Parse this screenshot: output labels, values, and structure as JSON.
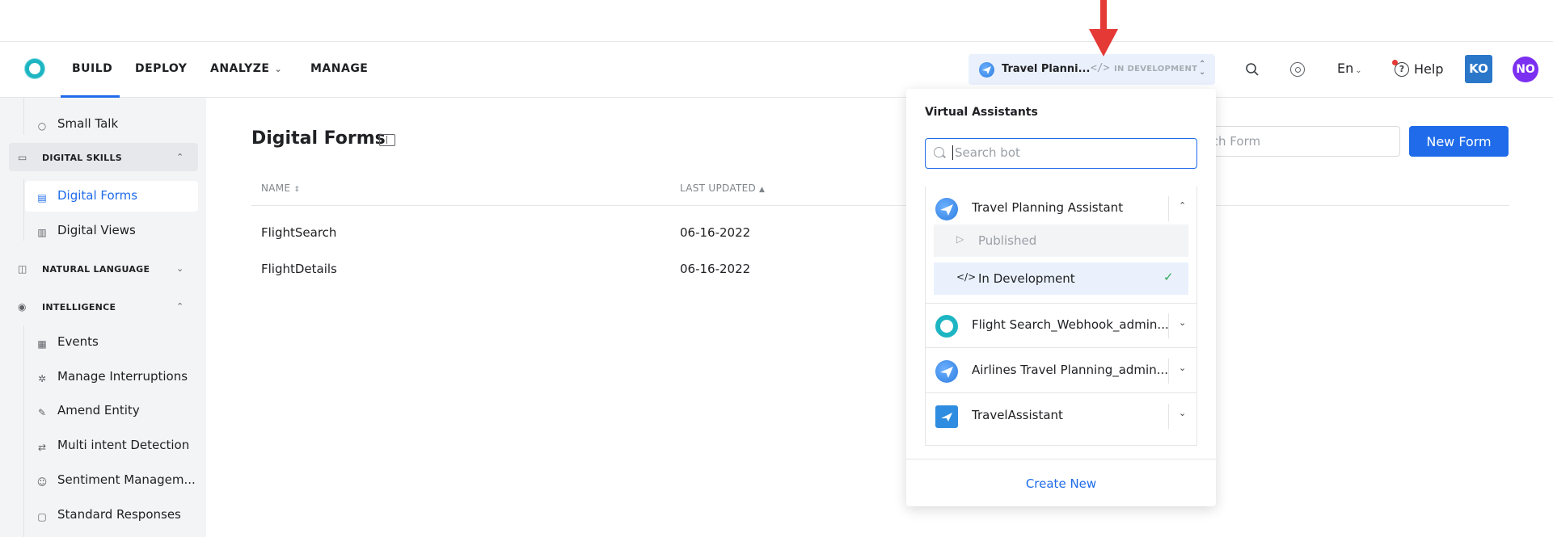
{
  "nav": {
    "items": [
      "BUILD",
      "DEPLOY",
      "ANALYZE",
      "MANAGE"
    ],
    "bot_switch": {
      "name": "Travel Planni...",
      "status": "IN DEVELOPMENT"
    },
    "language": "En",
    "help": "Help",
    "user_initials_1": "KO",
    "user_initials_2": "NO",
    "colors": {
      "accent": "#1f6bea",
      "ko": "#2a76c9",
      "no": "#7b2ff0"
    }
  },
  "sidebar": {
    "items": {
      "small_talk": "Small Talk",
      "digital_skills": "DIGITAL SKILLS",
      "digital_forms": "Digital Forms",
      "digital_views": "Digital Views",
      "natural_language": "NATURAL LANGUAGE",
      "intelligence": "INTELLIGENCE",
      "events": "Events",
      "manage_interruptions": "Manage Interruptions",
      "amend_entity": "Amend Entity",
      "multi_intent": "Multi intent Detection",
      "sentiment": "Sentiment Managem...",
      "standard_responses": "Standard Responses"
    }
  },
  "main": {
    "title": "Digital Forms",
    "search_placeholder": "Search Form",
    "new_form_label": "New Form",
    "columns": {
      "name": "NAME",
      "last_updated": "LAST UPDATED"
    },
    "rows": [
      {
        "name": "FlightSearch",
        "last_updated": "06-16-2022"
      },
      {
        "name": "FlightDetails",
        "last_updated": "06-16-2022"
      }
    ]
  },
  "dropdown": {
    "title": "Virtual Assistants",
    "search_placeholder": "Search bot",
    "bots": [
      {
        "name": "Travel Planning Assistant",
        "avatar": "plane-icon"
      },
      {
        "name": "Flight Search_Webhook_admin...",
        "avatar": "ring-logo-icon"
      },
      {
        "name": "Airlines Travel Planning_admin...",
        "avatar": "plane-icon"
      },
      {
        "name": "TravelAssistant",
        "avatar": "travel-logo-icon"
      }
    ],
    "sub_published": "Published",
    "sub_in_development": "In Development",
    "create_new": "Create New"
  }
}
